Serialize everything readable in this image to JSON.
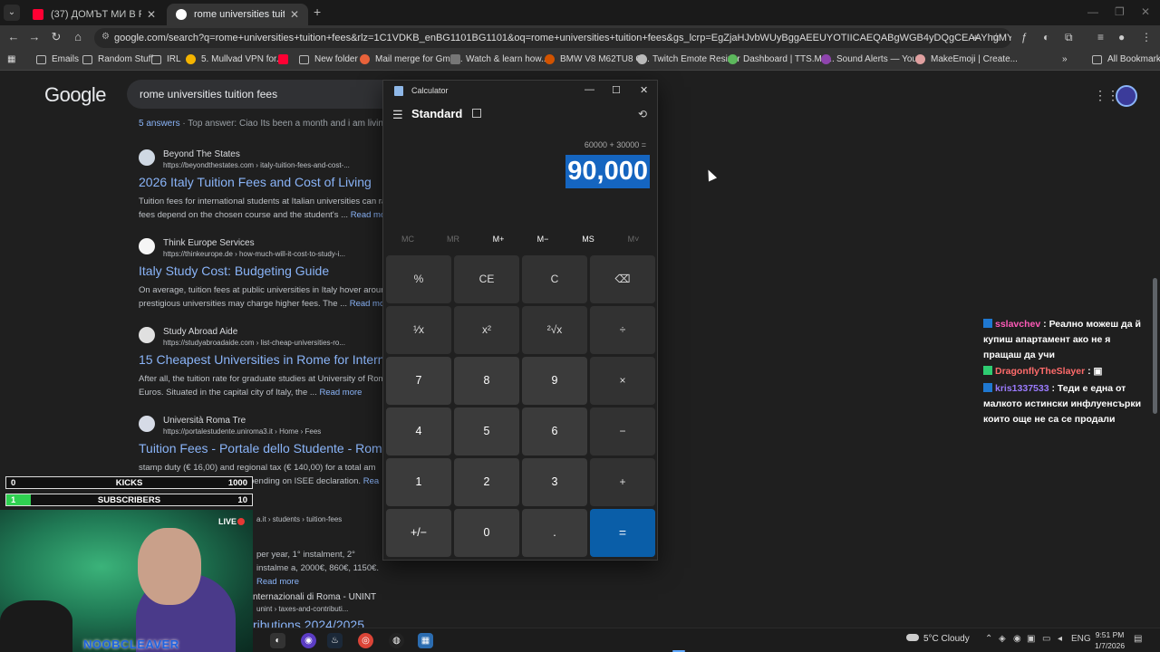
{
  "browser": {
    "tabs": [
      {
        "title": "(37) ДОМЪТ МИ В РИМ| Добр",
        "active": false,
        "favicon_color": "#ff0033"
      },
      {
        "title": "rome universities tuition fees -",
        "active": true,
        "favicon_color": "#ffffff"
      }
    ],
    "address": "google.com/search?q=rome+universities+tuition+fees&rlz=1C1VDKB_enBG1101BG1101&oq=rome+universities+tuition+fees&gs_lcrp=EgZjaHJvbWUyBggAEEUYOTIICAEQABgWGB4yDQgCEAAYhgMYgAQYigUyDQgDEAAYhg...",
    "bookmarks": [
      "Emails",
      "Random Stuff",
      "IRL",
      "5. Mullvad VPN for...",
      "New folder",
      "Mail merge for Gma...",
      "Watch & learn how...",
      "BMW V8 M62TU8 C...",
      "Twitch Emote Resizer",
      "Dashboard | TTS.Mo...",
      "Sound Alerts — You...",
      "MakeEmoji | Create...",
      "All Bookmarks"
    ]
  },
  "google": {
    "logo": "Google",
    "query": "rome universities tuition fees",
    "answers_count": "5 answers",
    "answers_text": " · Top answer: Ciao Its been a month and i am living as",
    "results": [
      {
        "site": "Beyond The States",
        "url": "https://beyondthestates.com › italy-tuition-fees-and-cost-...",
        "title": "2026 Italy Tuition Fees and Cost of Living",
        "snippet": "Tuition fees for international students at Italian universities can ra fees depend on the chosen course and the student's ...",
        "more": "Read mo"
      },
      {
        "site": "Think Europe Services",
        "url": "https://thinkeurope.de › how-much-will-it-cost-to-study-i...",
        "title": "Italy Study Cost: Budgeting Guide",
        "snippet": "On average, tuition fees at public universities in Italy hover aroun prestigious universities may charge higher fees. The ...",
        "more": "Read mo"
      },
      {
        "site": "Study Abroad Aide",
        "url": "https://studyabroadaide.com › list-cheap-universities-ro...",
        "title": "15 Cheapest Universities in Rome for Internat",
        "snippet": "After all, the tuition rate for graduate studies at University of Rom Euros. Situated in the capital city of Italy, the ...",
        "more": "Read more"
      },
      {
        "site": "Università Roma Tre",
        "url": "https://portalestudente.uniroma3.it › Home › Fees",
        "title": "Tuition Fees - Portale dello Studente - Roma T",
        "snippet": "stamp duty (€ 16,00) and regional tax (€ 140,00) for a total am students, variable amount depending on ISEE declaration.",
        "more": "Rea"
      },
      {
        "site": "",
        "url": "a.it › students › tuition-fees",
        "title": "",
        "snippet": "per year, 1° instalment, 2° instalme a, 2000€, 860€, 1150€.",
        "more": "Read more"
      },
      {
        "site": "nternazionali di Roma - UNINT",
        "url": "unint › taxes-and-contributi...",
        "title": "ributions 2024/2025",
        "snippet": "",
        "more": ""
      }
    ]
  },
  "overlay": {
    "kicks": {
      "current": "0",
      "label": "KICKS",
      "goal": "1000",
      "progress": 0.0
    },
    "subscribers": {
      "current": "1",
      "label": "SUBSCRIBERS",
      "goal": "10",
      "progress": 0.1
    },
    "live": "LIVE",
    "streamer": "NOOBCLEAVER",
    "chat": [
      {
        "user": "sslavchev",
        "text": "Реално можеш да й купиш апартамент ако не я пращаш да учи"
      },
      {
        "user": "DragonflyTheSlayer",
        "text": ""
      },
      {
        "user": "kris1337533",
        "text": "Теди е една от малкото истински инфлуенсърки които още не са се продали"
      }
    ]
  },
  "calculator": {
    "window_title": "Calculator",
    "mode": "Standard",
    "expression": "60000 + 30000 =",
    "display": "90,000",
    "memory": [
      {
        "label": "MC",
        "enabled": false
      },
      {
        "label": "MR",
        "enabled": false
      },
      {
        "label": "M+",
        "enabled": true
      },
      {
        "label": "M−",
        "enabled": true
      },
      {
        "label": "MS",
        "enabled": true
      },
      {
        "label": "M˅",
        "enabled": false
      }
    ],
    "keys": {
      "percent": "%",
      "ce": "CE",
      "c": "C",
      "backspace": "⌫",
      "reciprocal": "¹⁄x",
      "square": "x²",
      "sqrt": "²√x",
      "divide": "÷",
      "seven": "7",
      "eight": "8",
      "nine": "9",
      "multiply": "×",
      "four": "4",
      "five": "5",
      "six": "6",
      "minus": "−",
      "one": "1",
      "two": "2",
      "three": "3",
      "plus": "+",
      "negate": "+/−",
      "zero": "0",
      "decimal": ".",
      "equals": "="
    }
  },
  "taskbar": {
    "weather": "5°C  Cloudy",
    "language": "ENG",
    "time": "9:51 PM",
    "date": "1/7/2026"
  },
  "colors": {
    "accent": "#1565c0",
    "link": "#8ab4f8",
    "equals": "#0a5ea8",
    "progress": "#2fd151"
  }
}
